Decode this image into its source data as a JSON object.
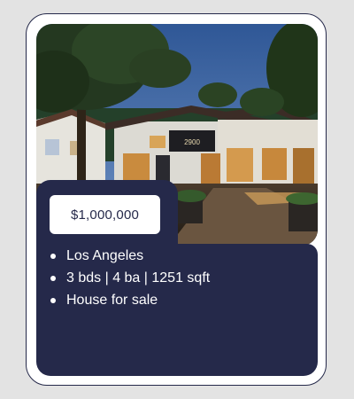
{
  "listing": {
    "price": "$1,000,000",
    "details": [
      "Los Angeles",
      "3 bds | 4 ba | 1251 sqft",
      "House for sale"
    ],
    "photo": {
      "subject": "house-exterior-dusk",
      "sign_text": "2900"
    }
  },
  "colors": {
    "accent": "#25294a",
    "background": "#e3e3e3",
    "card": "#ffffff",
    "sky": "#3a5f9a"
  }
}
